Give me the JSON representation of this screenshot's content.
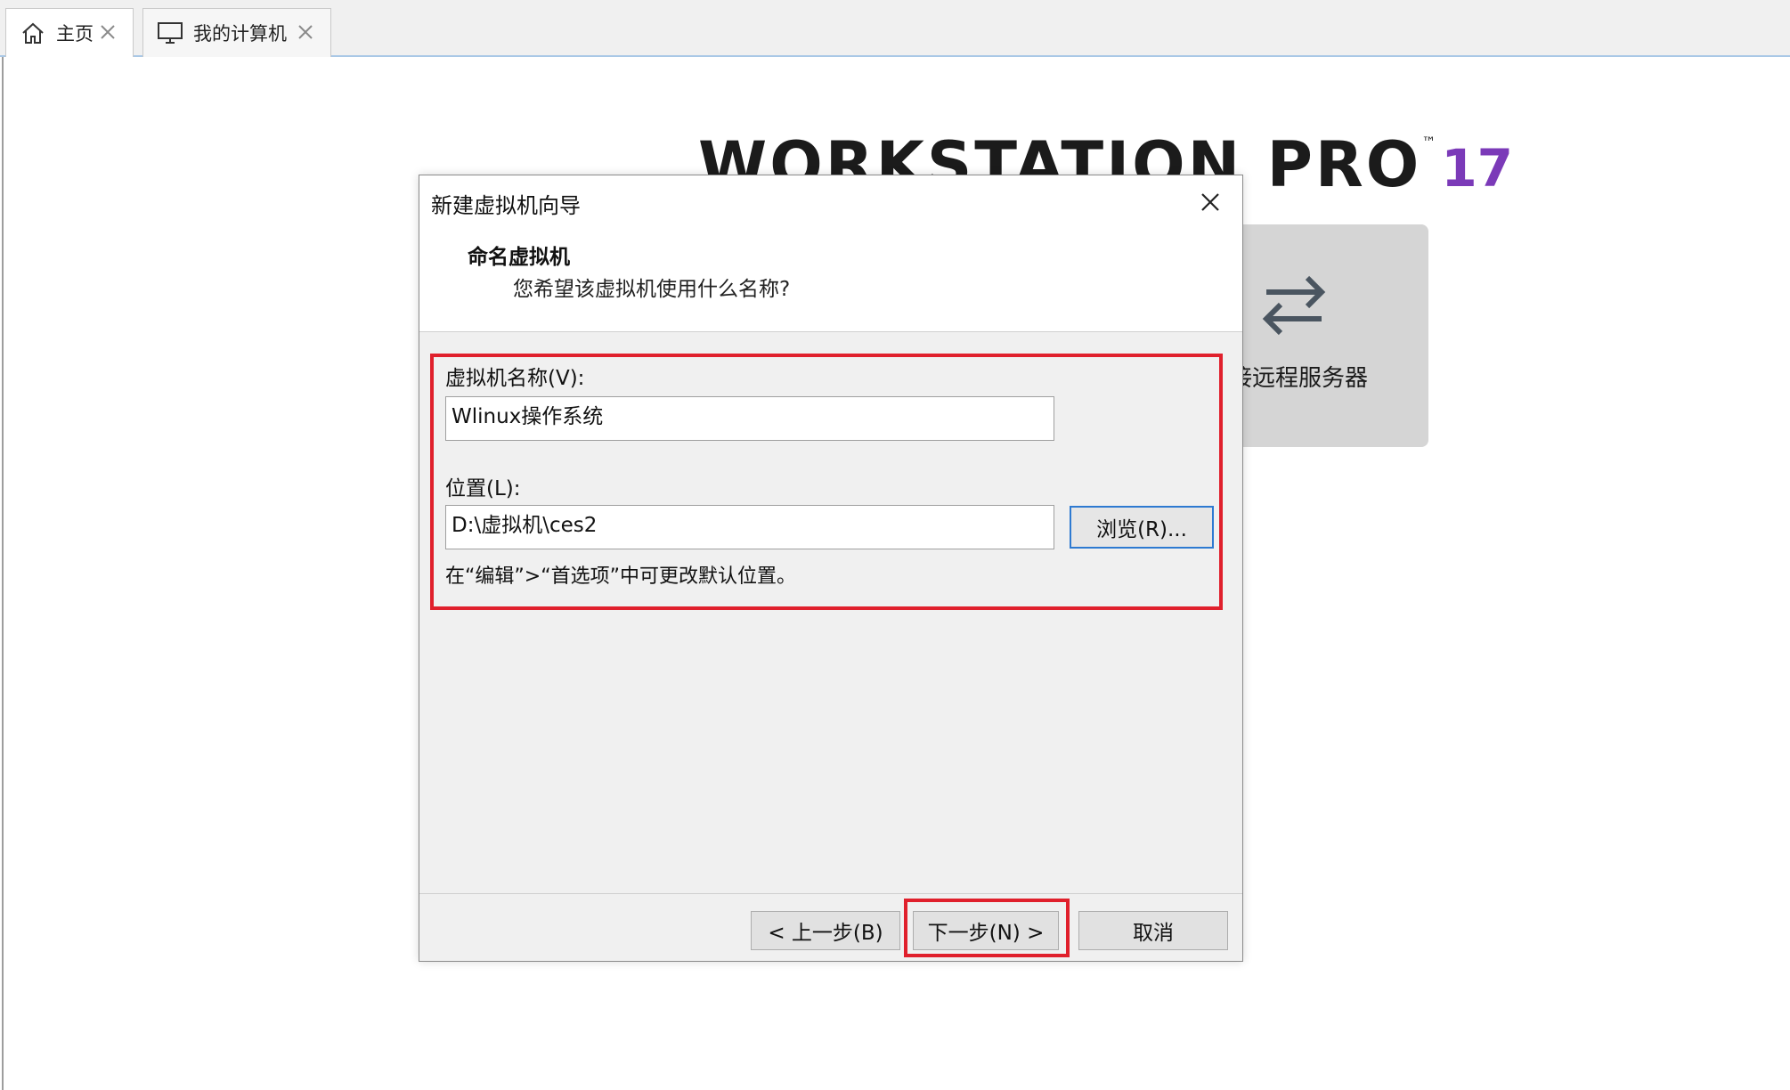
{
  "tabs": [
    {
      "label": "主页",
      "icon": "home-icon",
      "active": true
    },
    {
      "label": "我的计算机",
      "icon": "monitor-icon",
      "active": false
    }
  ],
  "background": {
    "brand_text": "WORKSTATION PRO",
    "brand_tm": "™",
    "brand_version": "17",
    "remote_label": "接远程服务器"
  },
  "dialog": {
    "title": "新建虚拟机向导",
    "step_title": "命名虚拟机",
    "step_subtitle": "您希望该虚拟机使用什么名称?",
    "vm_name_label": "虚拟机名称(V):",
    "vm_name_value": "Wlinux操作系统",
    "location_label": "位置(L):",
    "location_value": "D:\\虚拟机\\ces2",
    "browse_label": "浏览(R)...",
    "location_hint": "在“编辑”>“首选项”中可更改默认位置。",
    "back_label": "< 上一步(B)",
    "next_label": "下一步(N) >",
    "cancel_label": "取消"
  },
  "colors": {
    "highlight": "#e0202c",
    "brand_version": "#7b3ab8",
    "focus_border": "#2e7ad1"
  }
}
